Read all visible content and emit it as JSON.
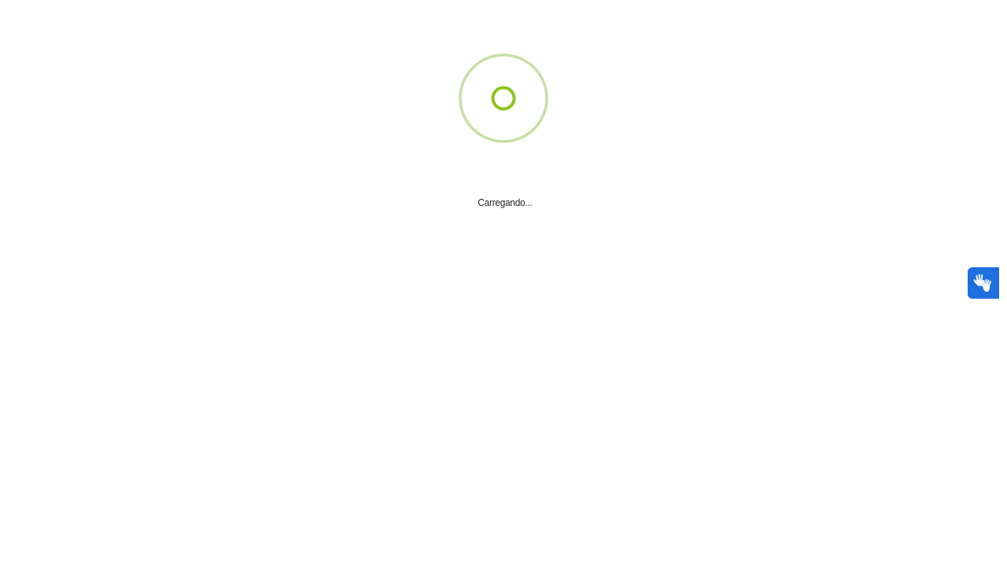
{
  "loading": {
    "text": "Carregando...",
    "outer_ring_color": "#c8dfa4",
    "inner_ring_color": "#8fc31f"
  },
  "accessibility_widget": {
    "icon": "sign-language-hands-icon",
    "background_color": "#1f6fde"
  }
}
